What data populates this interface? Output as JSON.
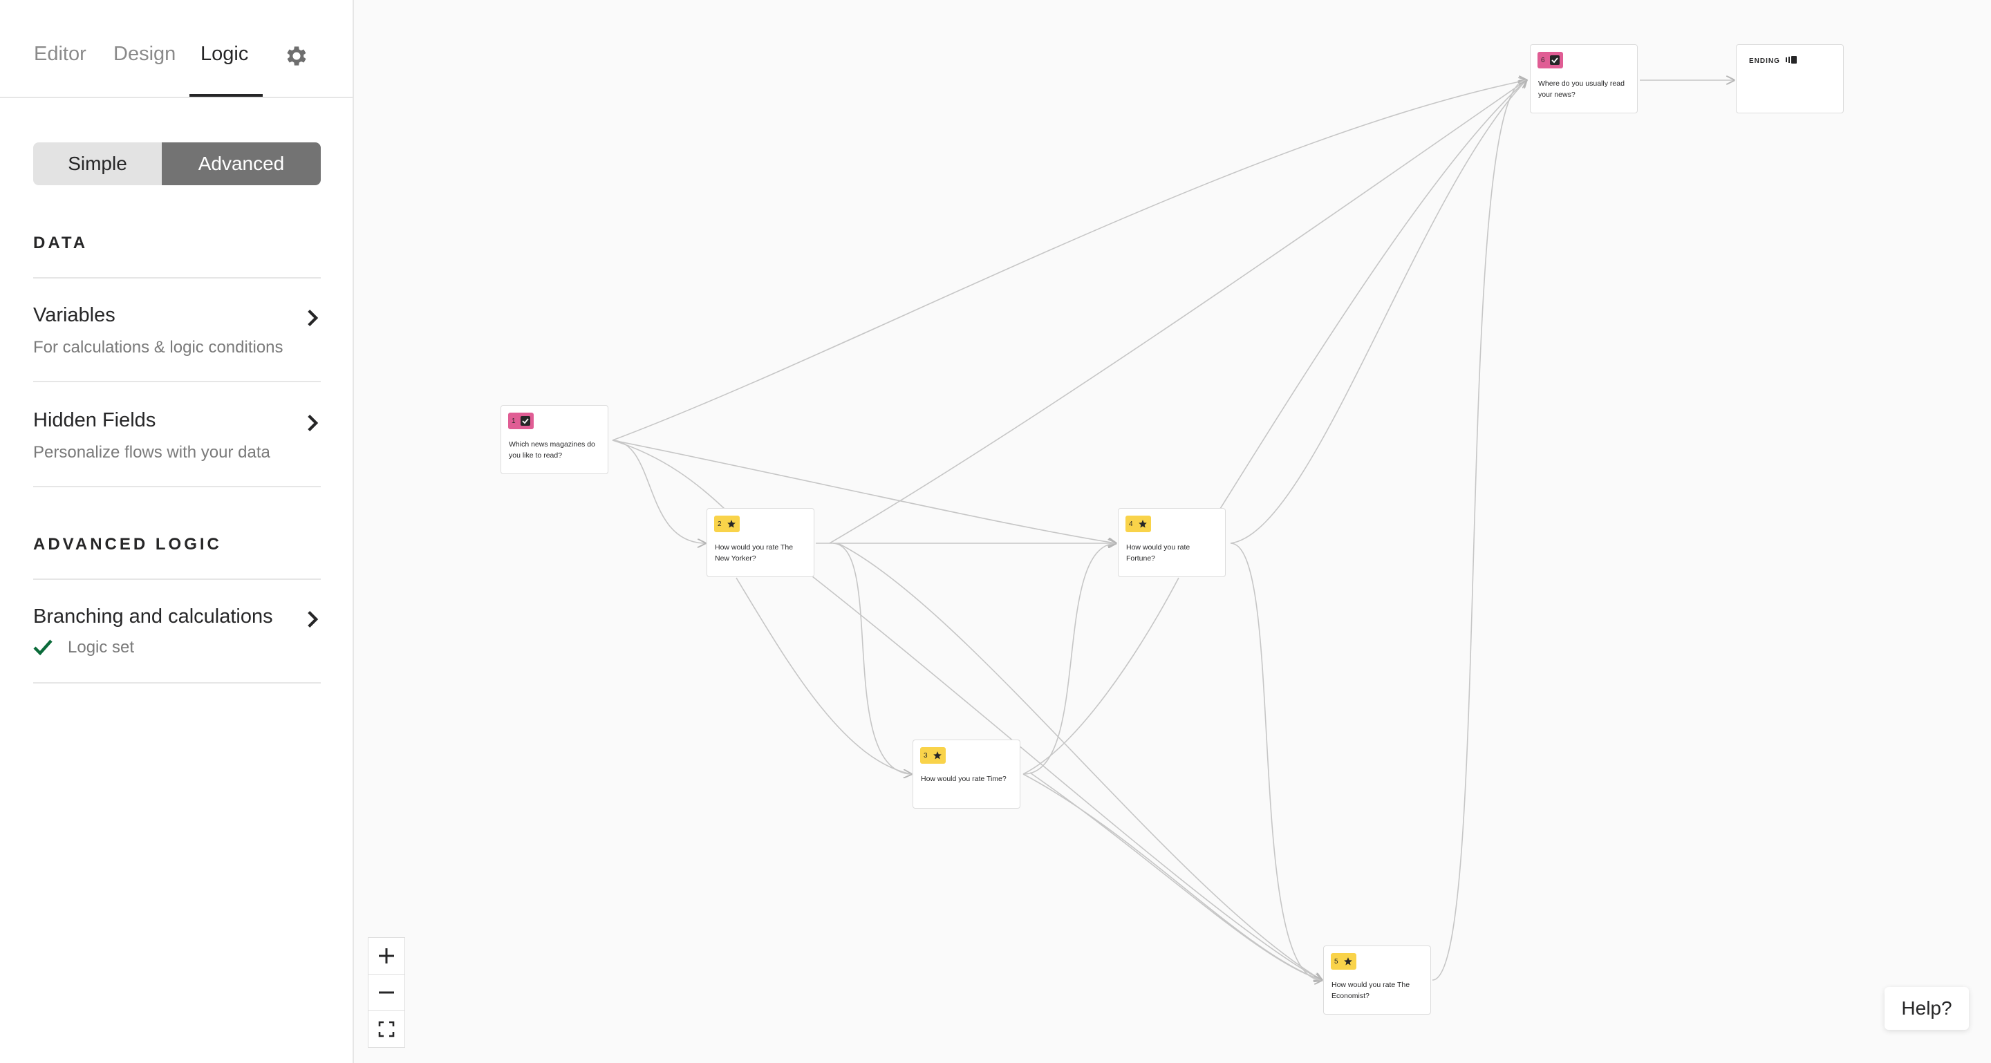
{
  "tabs": {
    "editor": "Editor",
    "design": "Design",
    "logic": "Logic"
  },
  "mode_toggle": {
    "simple": "Simple",
    "advanced": "Advanced",
    "selected": "Advanced"
  },
  "data_section": {
    "title": "DATA",
    "variables": {
      "title": "Variables",
      "subtitle": "For calculations & logic conditions"
    },
    "hidden_fields": {
      "title": "Hidden Fields",
      "subtitle": "Personalize flows with your data"
    }
  },
  "advanced_logic_section": {
    "title": "ADVANCED LOGIC",
    "branching": {
      "title": "Branching and calculations",
      "status": "Logic set"
    }
  },
  "nodes": {
    "q1": {
      "number": "1",
      "type_icon": "checkbox-icon",
      "text": "Which news magazines do you like to read?"
    },
    "q2": {
      "number": "2",
      "type_icon": "star-icon",
      "text": "How would you rate The New Yorker?"
    },
    "q3": {
      "number": "3",
      "type_icon": "star-icon",
      "text": "How would you rate Time?"
    },
    "q4": {
      "number": "4",
      "type_icon": "star-icon",
      "text": "How would you rate Fortune?"
    },
    "q5": {
      "number": "5",
      "type_icon": "star-icon",
      "text": "How would you rate The Economist?"
    },
    "q6": {
      "number": "6",
      "type_icon": "checkbox-icon",
      "text": "Where do you usually read your news?"
    },
    "ending": {
      "label": "ENDING"
    }
  },
  "help": {
    "label": "Help?"
  },
  "colors": {
    "multiple_choice_badge": "#e05d94",
    "rating_badge": "#f9d34a",
    "advanced_toggle": "#737373",
    "logic_set_check": "#0b6b3a"
  }
}
